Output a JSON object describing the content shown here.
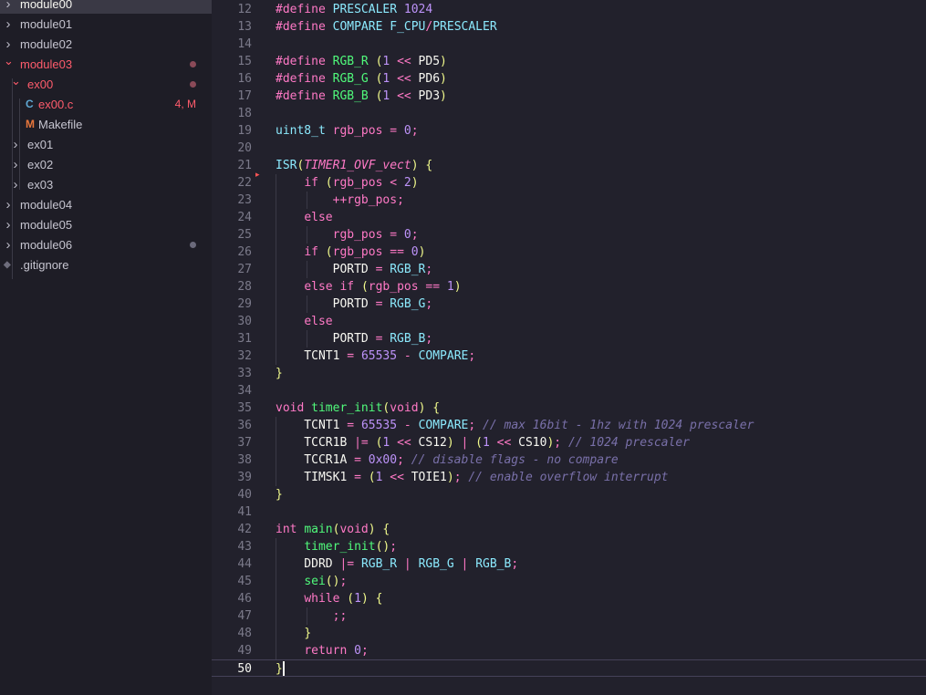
{
  "explorer": {
    "items": [
      {
        "label": "module00",
        "kind": "folder",
        "depth": 0,
        "expanded": false,
        "active": true,
        "color": "#f8f8f2"
      },
      {
        "label": "module01",
        "kind": "folder",
        "depth": 0,
        "expanded": false,
        "color": "#c6c5d0"
      },
      {
        "label": "module02",
        "kind": "folder",
        "depth": 0,
        "expanded": false,
        "color": "#c6c5d0"
      },
      {
        "label": "module03",
        "kind": "folder",
        "depth": 0,
        "expanded": true,
        "color": "#ff5c6c",
        "dot": "#8a4a58"
      },
      {
        "label": "ex00",
        "kind": "folder",
        "depth": 1,
        "expanded": true,
        "color": "#ff5c6c",
        "dot": "#8a4a58"
      },
      {
        "label": "ex00.c",
        "kind": "c-file",
        "depth": 2,
        "color": "#ff5c6c",
        "badge": "4, M",
        "icon": "C"
      },
      {
        "label": "Makefile",
        "kind": "makefile",
        "depth": 2,
        "color": "#c6c5d0",
        "icon": "M"
      },
      {
        "label": "ex01",
        "kind": "folder",
        "depth": 1,
        "expanded": false,
        "color": "#c6c5d0"
      },
      {
        "label": "ex02",
        "kind": "folder",
        "depth": 1,
        "expanded": false,
        "color": "#c6c5d0"
      },
      {
        "label": "ex03",
        "kind": "folder",
        "depth": 1,
        "expanded": false,
        "color": "#c6c5d0"
      },
      {
        "label": "module04",
        "kind": "folder",
        "depth": 0,
        "expanded": false,
        "color": "#c6c5d0"
      },
      {
        "label": "module05",
        "kind": "folder",
        "depth": 0,
        "expanded": false,
        "color": "#c6c5d0"
      },
      {
        "label": "module06",
        "kind": "folder",
        "depth": 0,
        "expanded": false,
        "color": "#c6c5d0",
        "dot": "#6b6a7b"
      },
      {
        "label": ".gitignore",
        "kind": "git-file",
        "depth": 0,
        "color": "#c6c5d0"
      }
    ]
  },
  "editor": {
    "current_line": 50,
    "lines": [
      {
        "n": 12,
        "text": "#define PRESCALER 1024"
      },
      {
        "n": 13,
        "text": "#define COMPARE F_CPU/PRESCALER"
      },
      {
        "n": 14,
        "text": ""
      },
      {
        "n": 15,
        "text": "#define RGB_R (1 << PD5)"
      },
      {
        "n": 16,
        "text": "#define RGB_G (1 << PD6)"
      },
      {
        "n": 17,
        "text": "#define RGB_B (1 << PD3)"
      },
      {
        "n": 18,
        "text": ""
      },
      {
        "n": 19,
        "text": "uint8_t rgb_pos = 0;"
      },
      {
        "n": 20,
        "text": ""
      },
      {
        "n": 21,
        "text": "ISR(TIMER1_OVF_vect) {"
      },
      {
        "n": 22,
        "text": "    if (rgb_pos < 2)"
      },
      {
        "n": 23,
        "text": "        ++rgb_pos;"
      },
      {
        "n": 24,
        "text": "    else"
      },
      {
        "n": 25,
        "text": "        rgb_pos = 0;"
      },
      {
        "n": 26,
        "text": "    if (rgb_pos == 0)"
      },
      {
        "n": 27,
        "text": "        PORTD = RGB_R;"
      },
      {
        "n": 28,
        "text": "    else if (rgb_pos == 1)"
      },
      {
        "n": 29,
        "text": "        PORTD = RGB_G;"
      },
      {
        "n": 30,
        "text": "    else"
      },
      {
        "n": 31,
        "text": "        PORTD = RGB_B;"
      },
      {
        "n": 32,
        "text": "    TCNT1 = 65535 - COMPARE;"
      },
      {
        "n": 33,
        "text": "}"
      },
      {
        "n": 34,
        "text": ""
      },
      {
        "n": 35,
        "text": "void timer_init(void) {"
      },
      {
        "n": 36,
        "text": "    TCNT1 = 65535 - COMPARE; // max 16bit - 1hz with 1024 prescaler"
      },
      {
        "n": 37,
        "text": "    TCCR1B |= (1 << CS12) | (1 << CS10); // 1024 prescaler"
      },
      {
        "n": 38,
        "text": "    TCCR1A = 0x00; // disable flags - no compare"
      },
      {
        "n": 39,
        "text": "    TIMSK1 = (1 << TOIE1); // enable overflow interrupt"
      },
      {
        "n": 40,
        "text": "}"
      },
      {
        "n": 41,
        "text": ""
      },
      {
        "n": 42,
        "text": "int main(void) {"
      },
      {
        "n": 43,
        "text": "    timer_init();"
      },
      {
        "n": 44,
        "text": "    DDRD |= RGB_R | RGB_G | RGB_B;"
      },
      {
        "n": 45,
        "text": "    sei();"
      },
      {
        "n": 46,
        "text": "    while (1) {"
      },
      {
        "n": 47,
        "text": "        ;;"
      },
      {
        "n": 48,
        "text": "    }"
      },
      {
        "n": 49,
        "text": "    return 0;"
      },
      {
        "n": 50,
        "text": "}"
      }
    ]
  },
  "colors": {
    "sidebar_bg": "#1e1d26",
    "editor_bg": "#22212c",
    "keyword": "#ff79c6",
    "type": "#8be9fd",
    "function": "#50fa7b",
    "number": "#bd93f9",
    "comment": "#7970a9",
    "modified": "#ff5c6c"
  }
}
